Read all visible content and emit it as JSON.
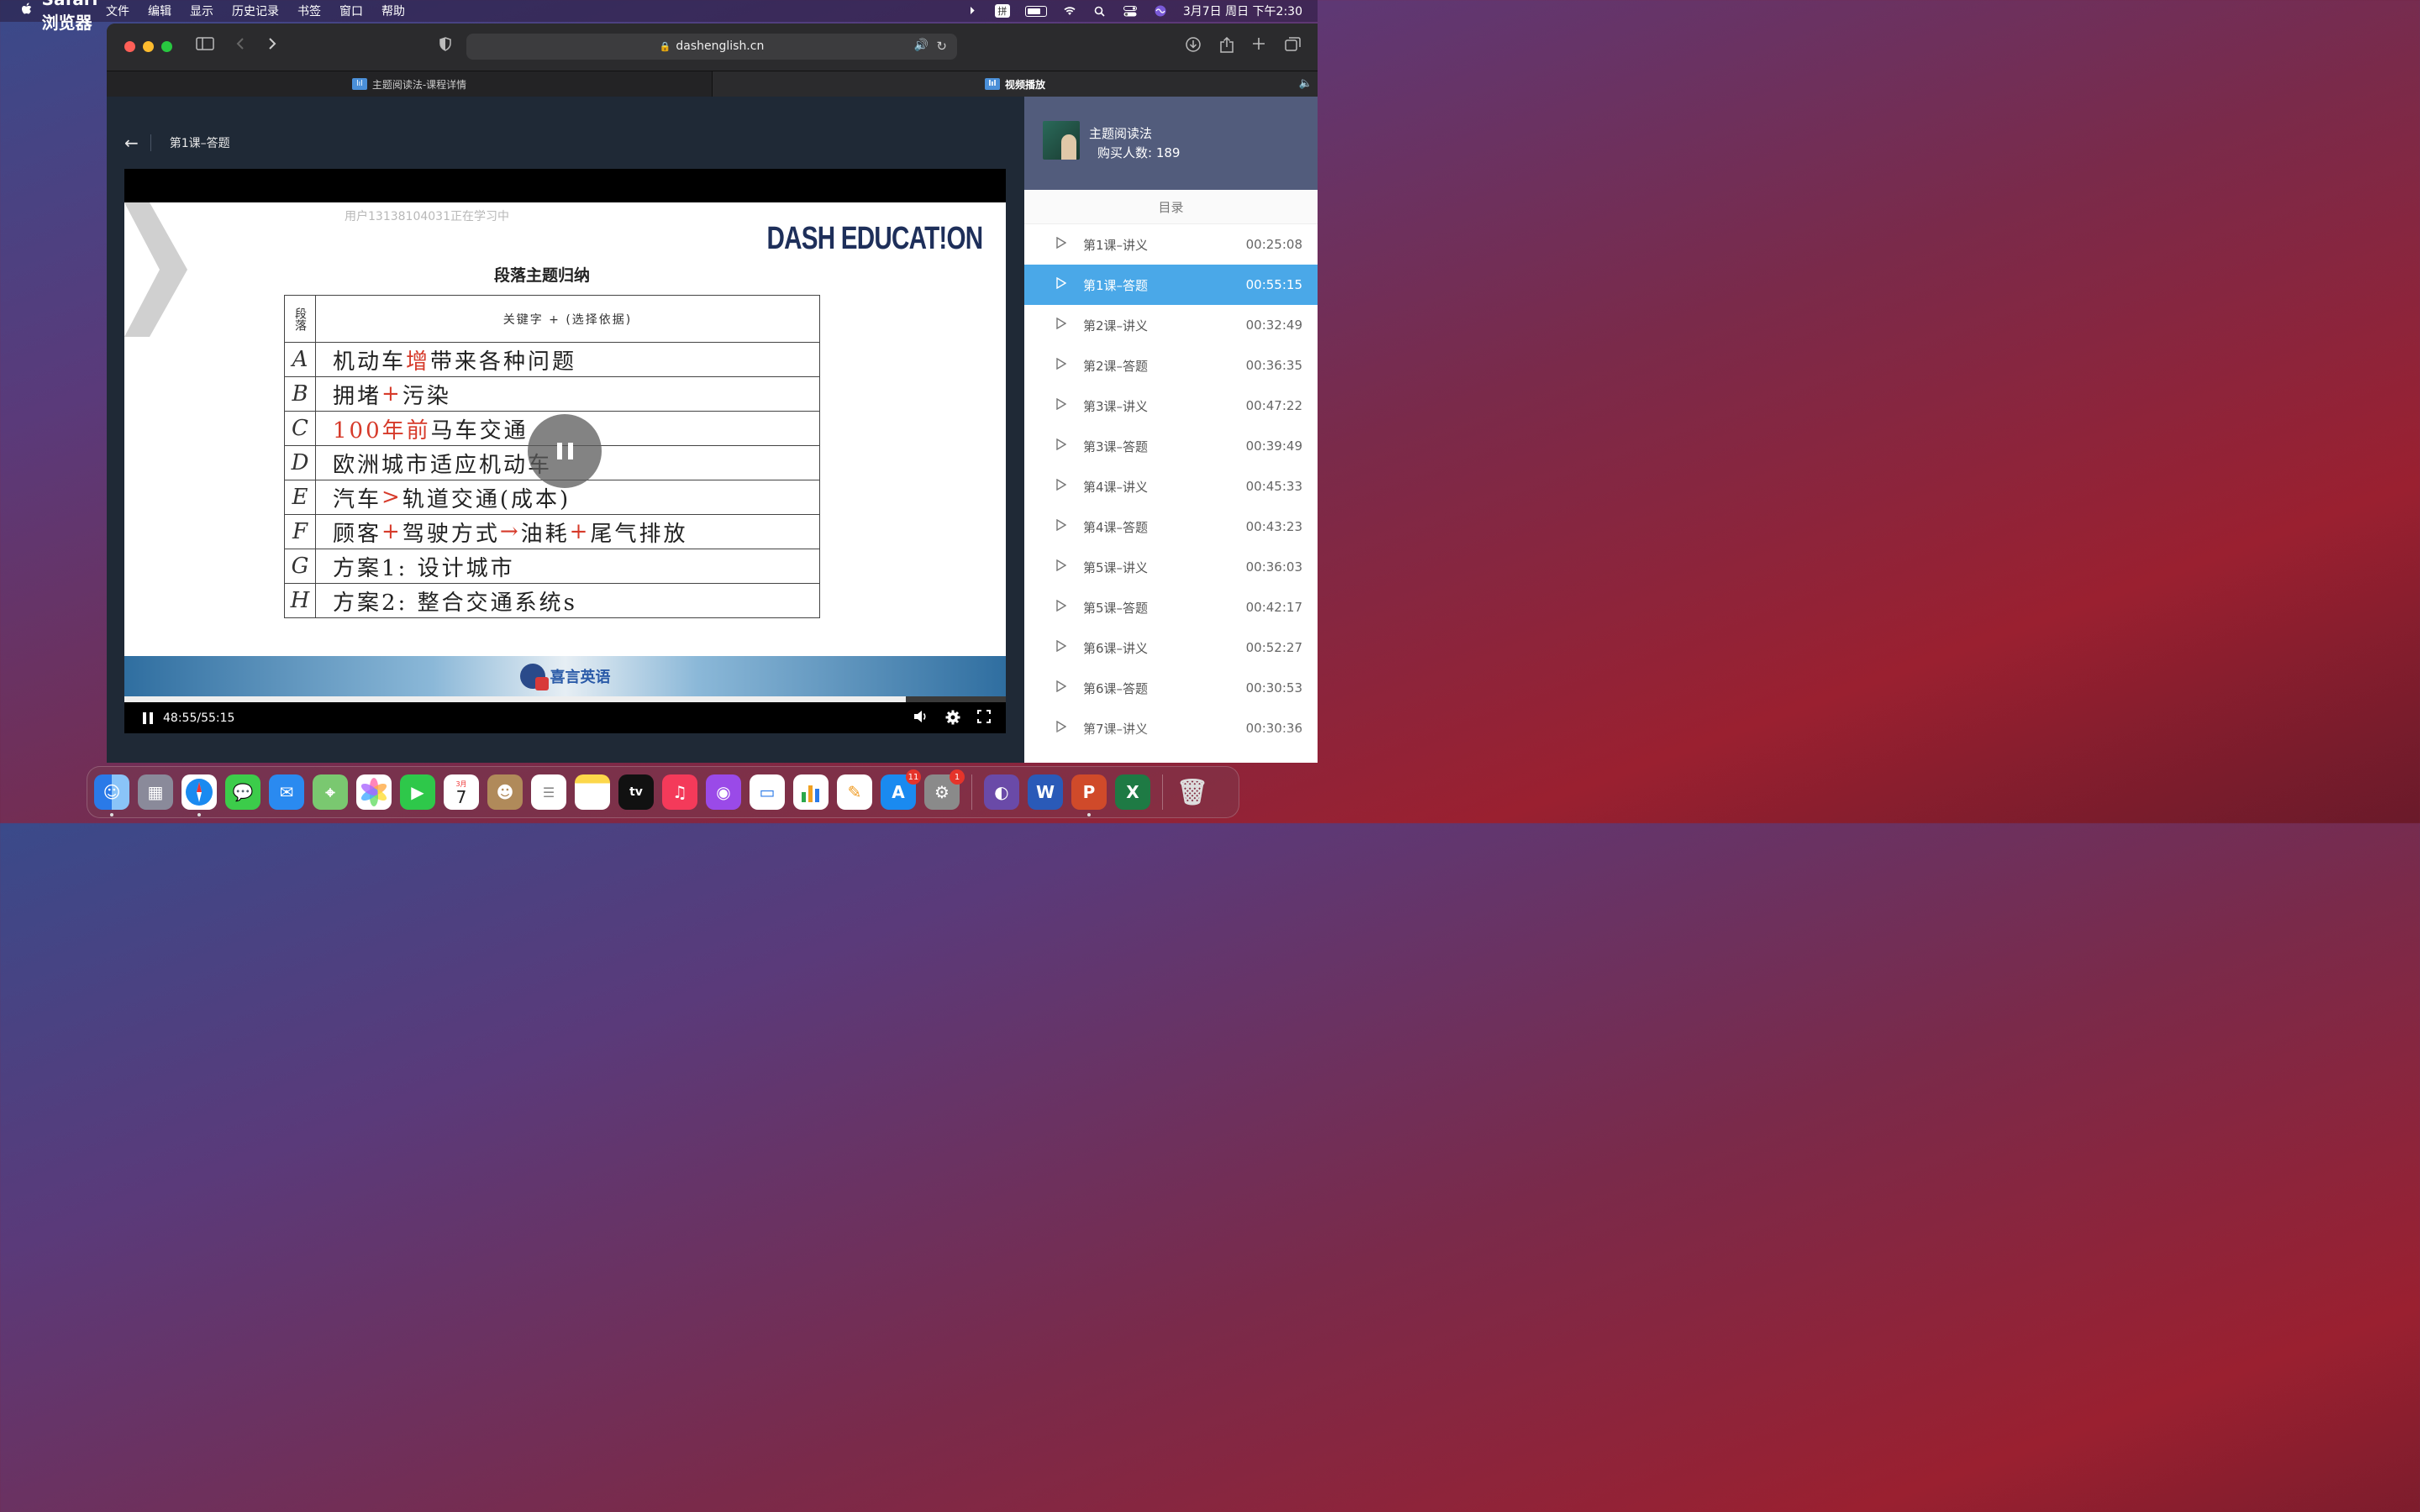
{
  "menubar": {
    "app_name": "Safari浏览器",
    "items": [
      "文件",
      "编辑",
      "显示",
      "历史记录",
      "书签",
      "窗口",
      "帮助"
    ],
    "ime_label": "拼",
    "datetime": "3月7日 周日 下午2:30"
  },
  "browser": {
    "url": "dashenglish.cn",
    "tabs": [
      {
        "label": "主题阅读法-课程详情",
        "active": false
      },
      {
        "label": "视频播放",
        "active": true
      }
    ]
  },
  "lesson": {
    "title": "第1课–答题"
  },
  "video": {
    "watermark": "用户13138104031正在学习中",
    "logo": "DASH EDUCAT!ON",
    "slide_title": "段落主题归纳",
    "table_header": {
      "col1": "段落",
      "col2": "关键字 + (选择依据)"
    },
    "rows": [
      {
        "letter": "A",
        "parts": [
          {
            "t": "机动车",
            "red": false
          },
          {
            "t": "增",
            "red": true
          },
          {
            "t": " 带来各种问题",
            "red": false
          }
        ]
      },
      {
        "letter": "B",
        "parts": [
          {
            "t": "拥堵",
            "red": false
          },
          {
            "t": "+",
            "red": true
          },
          {
            "t": "污染",
            "red": false
          }
        ]
      },
      {
        "letter": "C",
        "parts": [
          {
            "t": "100年前",
            "red": true
          },
          {
            "t": " 马车交通",
            "red": false
          }
        ]
      },
      {
        "letter": "D",
        "parts": [
          {
            "t": "欧洲城市适应机动车",
            "red": false
          }
        ]
      },
      {
        "letter": "E",
        "parts": [
          {
            "t": "汽车",
            "red": false
          },
          {
            "t": ">",
            "red": true
          },
          {
            "t": "轨道交通(成本)",
            "red": false
          }
        ]
      },
      {
        "letter": "F",
        "parts": [
          {
            "t": "顾客",
            "red": false
          },
          {
            "t": "+",
            "red": true
          },
          {
            "t": "驾驶方式 ",
            "red": false
          },
          {
            "t": "→",
            "red": true
          },
          {
            "t": " 油耗",
            "red": false
          },
          {
            "t": "+",
            "red": true
          },
          {
            "t": "尾气排放",
            "red": false
          }
        ]
      },
      {
        "letter": "G",
        "parts": [
          {
            "t": "方案1: 设计城市",
            "red": false
          }
        ]
      },
      {
        "letter": "H",
        "parts": [
          {
            "t": "方案2: 整合交通系统s",
            "red": false
          }
        ]
      }
    ],
    "brand": "喜言英语",
    "time_display": "48:55/55:15",
    "progress_fraction": 0.887
  },
  "course": {
    "title": "主题阅读法",
    "buyers_label": "购买人数: 189",
    "toc_title": "目录",
    "lessons": [
      {
        "label": "第1课–讲义",
        "duration": "00:25:08",
        "active": false
      },
      {
        "label": "第1课–答题",
        "duration": "00:55:15",
        "active": true
      },
      {
        "label": "第2课–讲义",
        "duration": "00:32:49",
        "active": false
      },
      {
        "label": "第2课–答题",
        "duration": "00:36:35",
        "active": false
      },
      {
        "label": "第3课–讲义",
        "duration": "00:47:22",
        "active": false
      },
      {
        "label": "第3课–答题",
        "duration": "00:39:49",
        "active": false
      },
      {
        "label": "第4课–讲义",
        "duration": "00:45:33",
        "active": false
      },
      {
        "label": "第4课–答题",
        "duration": "00:43:23",
        "active": false
      },
      {
        "label": "第5课–讲义",
        "duration": "00:36:03",
        "active": false
      },
      {
        "label": "第5课–答题",
        "duration": "00:42:17",
        "active": false
      },
      {
        "label": "第6课–讲义",
        "duration": "00:52:27",
        "active": false
      },
      {
        "label": "第6课–答题",
        "duration": "00:30:53",
        "active": false
      },
      {
        "label": "第7课–讲义",
        "duration": "00:30:36",
        "active": false
      }
    ]
  },
  "dock": {
    "calendar_month": "3月",
    "calendar_day": "7",
    "appstore_badge": "11",
    "settings_badge": "1"
  }
}
